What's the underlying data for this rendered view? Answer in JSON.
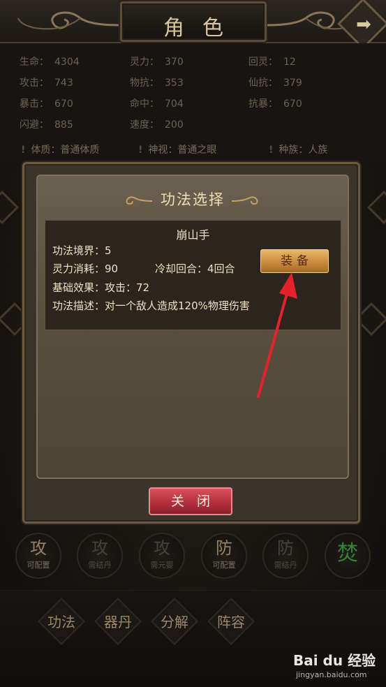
{
  "header": {
    "title": "角色"
  },
  "stats": [
    {
      "label": "生命：",
      "value": "4304"
    },
    {
      "label": "灵力：",
      "value": "370"
    },
    {
      "label": "回灵：",
      "value": "12"
    },
    {
      "label": "攻击：",
      "value": "743"
    },
    {
      "label": "物抗：",
      "value": "353"
    },
    {
      "label": "仙抗：",
      "value": "379"
    },
    {
      "label": "暴击：",
      "value": "670"
    },
    {
      "label": "命中：",
      "value": "704"
    },
    {
      "label": "抗暴：",
      "value": "670"
    },
    {
      "label": "闪避：",
      "value": "885"
    },
    {
      "label": "速度：",
      "value": "200"
    }
  ],
  "info": [
    {
      "text": "体质：普通体质"
    },
    {
      "text": "神视：普通之眼"
    },
    {
      "text": "种族：人族"
    }
  ],
  "modal": {
    "title": "功法选择",
    "skill_name": "崩山手",
    "realm": "功法境界：5",
    "mana_cost": "灵力消耗：90",
    "cooldown": "冷却回合：4回合",
    "base_effect": "基础效果：攻击：72",
    "description": "功法描述：对一个敌人造成120%物理伤害",
    "equip_label": "装备",
    "close_label": "关闭"
  },
  "slots": [
    {
      "big": "攻",
      "small": "可配置",
      "active": true
    },
    {
      "big": "攻",
      "small": "需结丹",
      "active": false
    },
    {
      "big": "攻",
      "small": "需元婴",
      "active": false
    },
    {
      "big": "防",
      "small": "可配置",
      "active": true
    },
    {
      "big": "防",
      "small": "需结丹",
      "active": false
    },
    {
      "big": "焚",
      "small": "",
      "active": true
    }
  ],
  "nav": [
    {
      "label": "功法"
    },
    {
      "label": "器丹"
    },
    {
      "label": "分解"
    },
    {
      "label": "阵容"
    }
  ],
  "watermark": {
    "logo": "Bai du 经验",
    "url": "jingyan.baidu.com"
  },
  "colors": {
    "equip": "#c98b3c",
    "close": "#b02f3b",
    "fen": "#46b04a",
    "arrow": "#e8202a"
  }
}
